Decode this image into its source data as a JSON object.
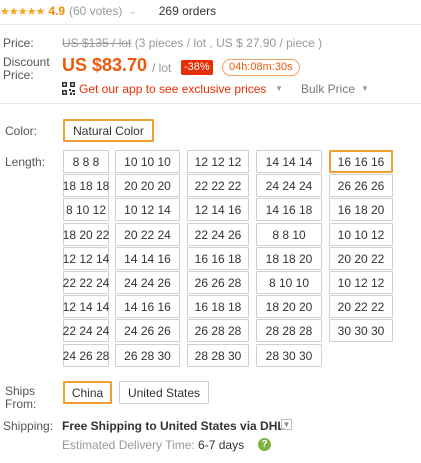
{
  "rating": {
    "stars": "★★★★★",
    "score": "4.9",
    "votes": "(60 votes)",
    "orders": "269 orders",
    "chevron": "⌄"
  },
  "price": {
    "label": "Price:",
    "original": "US $135 / lot",
    "original_detail": " (3 pieces / lot , US $ 27.90 / piece )",
    "discount_label": "Discount Price:",
    "discount_value": "US $83.70",
    "per_lot": "/ lot",
    "discount_badge": "-38%",
    "countdown": "04h:08m:30s",
    "app_promo": "Get our app to see exclusive prices",
    "bulk_price": "Bulk Price",
    "dropdown_icon": "▼"
  },
  "color": {
    "label": "Color:",
    "options": [
      "Natural Color"
    ],
    "selected": 0
  },
  "length": {
    "label": "Length:",
    "options": [
      "8 8 8",
      "10 10 10",
      "12 12 12",
      "14 14 14",
      "16 16 16",
      "18 18 18",
      "20 20 20",
      "22 22 22",
      "24 24 24",
      "26 26 26",
      "8 10 12",
      "10 12 14",
      "12 14 16",
      "14 16 18",
      "16 18 20",
      "18 20 22",
      "20 22 24",
      "22 24 26",
      "8 8 10",
      "10 10 12",
      "12 12 14",
      "14 14 16",
      "16 16 18",
      "18 18 20",
      "20 20 22",
      "22 22 24",
      "24 24 26",
      "26 26 28",
      "8 10 10",
      "10 12 12",
      "12 14 14",
      "14 16 16",
      "16 18 18",
      "18 20 20",
      "20 22 22",
      "22 24 24",
      "24 26 26",
      "26 28 28",
      "28 28 28",
      "30 30 30",
      "24 26 28",
      "26 28 30",
      "28 28 30",
      "28 30 30"
    ],
    "selected": 4
  },
  "ships_from": {
    "label": "Ships From:",
    "options": [
      "China",
      "United States"
    ],
    "selected": 0
  },
  "shipping": {
    "label": "Shipping:",
    "free_text": "Free Shipping",
    "to_text": " to United States via DHL",
    "delivery_label": "Estimated Delivery Time: ",
    "delivery_days": "6-7 days",
    "help_icon": "?"
  },
  "colors": {
    "accent_orange": "#f0580a",
    "selected_border": "#f0a030",
    "promo_red": "#e62e04",
    "star": "#f5a623"
  }
}
